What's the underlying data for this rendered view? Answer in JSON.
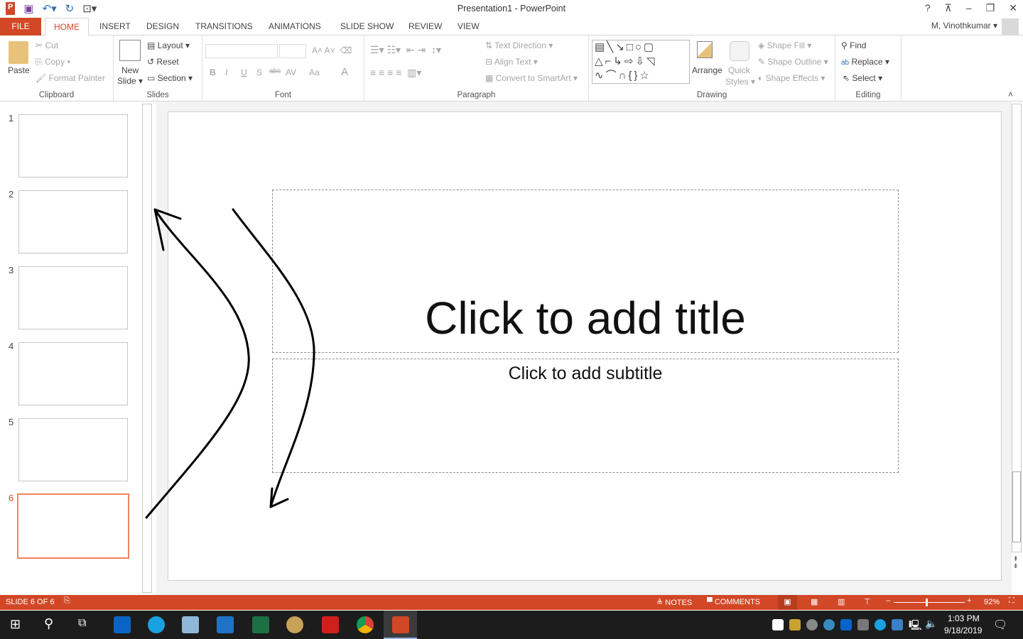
{
  "window": {
    "title": "Presentation1 - PowerPoint",
    "help": "?",
    "user": "M, Vinothkumar"
  },
  "tabs": [
    "FILE",
    "HOME",
    "INSERT",
    "DESIGN",
    "TRANSITIONS",
    "ANIMATIONS",
    "SLIDE SHOW",
    "REVIEW",
    "VIEW"
  ],
  "ribbon": {
    "clipboard": {
      "label": "Clipboard",
      "paste": "Paste",
      "cut": "Cut",
      "copy": "Copy",
      "format_painter": "Format Painter"
    },
    "slides": {
      "label": "Slides",
      "new_slide": "New",
      "new_slide2": "Slide",
      "layout": "Layout",
      "reset": "Reset",
      "section": "Section"
    },
    "font": {
      "label": "Font",
      "bold": "B",
      "italic": "I",
      "underline": "U",
      "shadow": "S",
      "strike": "abc",
      "spacing": "AV",
      "case": "Aa",
      "color": "A"
    },
    "paragraph": {
      "label": "Paragraph",
      "text_direction": "Text Direction",
      "align_text": "Align Text",
      "convert_smartart": "Convert to SmartArt"
    },
    "drawing": {
      "label": "Drawing",
      "arrange": "Arrange",
      "quick": "Quick",
      "styles": "Styles",
      "shape_fill": "Shape Fill",
      "shape_outline": "Shape Outline",
      "shape_effects": "Shape Effects"
    },
    "editing": {
      "label": "Editing",
      "find": "Find",
      "replace": "Replace",
      "select": "Select"
    }
  },
  "thumbnails": [
    {
      "n": "1"
    },
    {
      "n": "2"
    },
    {
      "n": "3"
    },
    {
      "n": "4"
    },
    {
      "n": "5"
    },
    {
      "n": "6",
      "selected": true
    }
  ],
  "slide": {
    "title": "Click to add title",
    "subtitle": "Click to add subtitle"
  },
  "status": {
    "slide": "SLIDE 6 OF 6",
    "notes": "NOTES",
    "comments": "COMMENTS",
    "zoom": "92%"
  },
  "taskbar": {
    "time": "1:03 PM",
    "date": "9/18/2019"
  },
  "colors": {
    "accent": "#D24726"
  }
}
